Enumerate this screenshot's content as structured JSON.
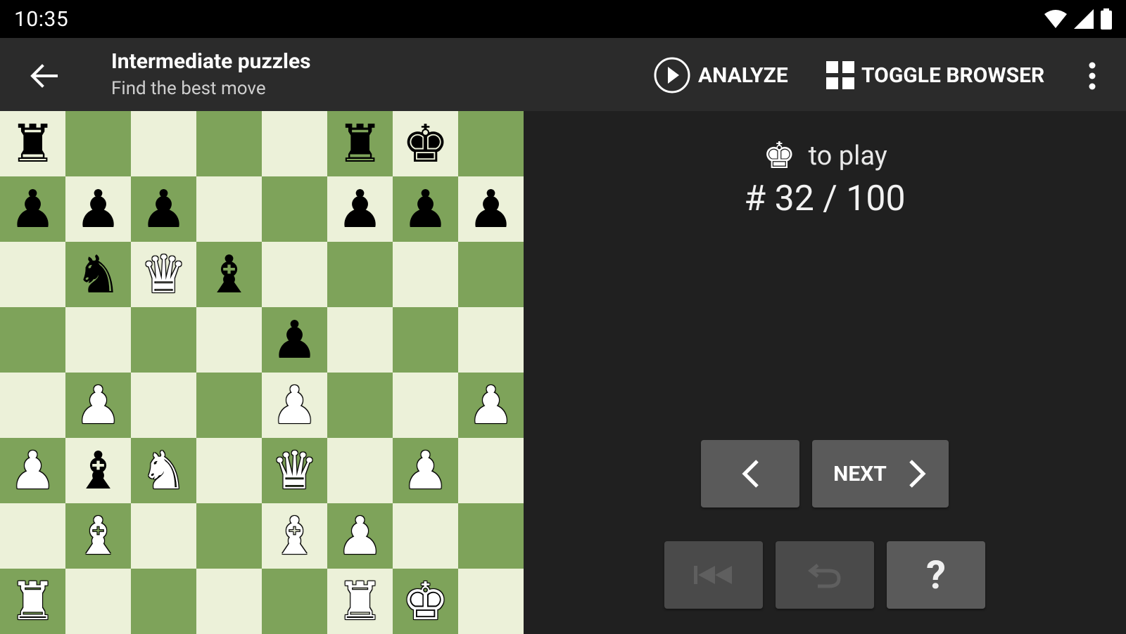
{
  "status_bar": {
    "time": "10:35"
  },
  "app_bar": {
    "title": "Intermediate puzzles",
    "subtitle": "Find the best move",
    "analyze_label": "ANALYZE",
    "toggle_browser_label": "TOGGLE BROWSER"
  },
  "puzzle": {
    "turn_text": "to play",
    "counter": "# 32 / 100"
  },
  "controls": {
    "next_label": "NEXT",
    "hint_label": "?"
  },
  "board": {
    "light_color": "#ecf1d9",
    "dark_color": "#7ea35a",
    "ranks": [
      [
        "bR",
        "",
        "",
        "",
        "",
        "bR",
        "bK",
        ""
      ],
      [
        "bP",
        "bP",
        "bP",
        "",
        "",
        "bP",
        "bP",
        "bP"
      ],
      [
        "",
        "bN",
        "wQ",
        "bB",
        "",
        "",
        "",
        ""
      ],
      [
        "",
        "",
        "",
        "",
        "bP",
        "",
        "",
        ""
      ],
      [
        "",
        "wP",
        "",
        "",
        "wP",
        "",
        "",
        "wP"
      ],
      [
        "wP",
        "bB",
        "wN",
        "",
        "wQ",
        "",
        "wP",
        ""
      ],
      [
        "",
        "wB",
        "",
        "",
        "wB",
        "wP",
        "",
        ""
      ],
      [
        "wR",
        "",
        "",
        "",
        "",
        "wR",
        "wK",
        ""
      ]
    ]
  }
}
